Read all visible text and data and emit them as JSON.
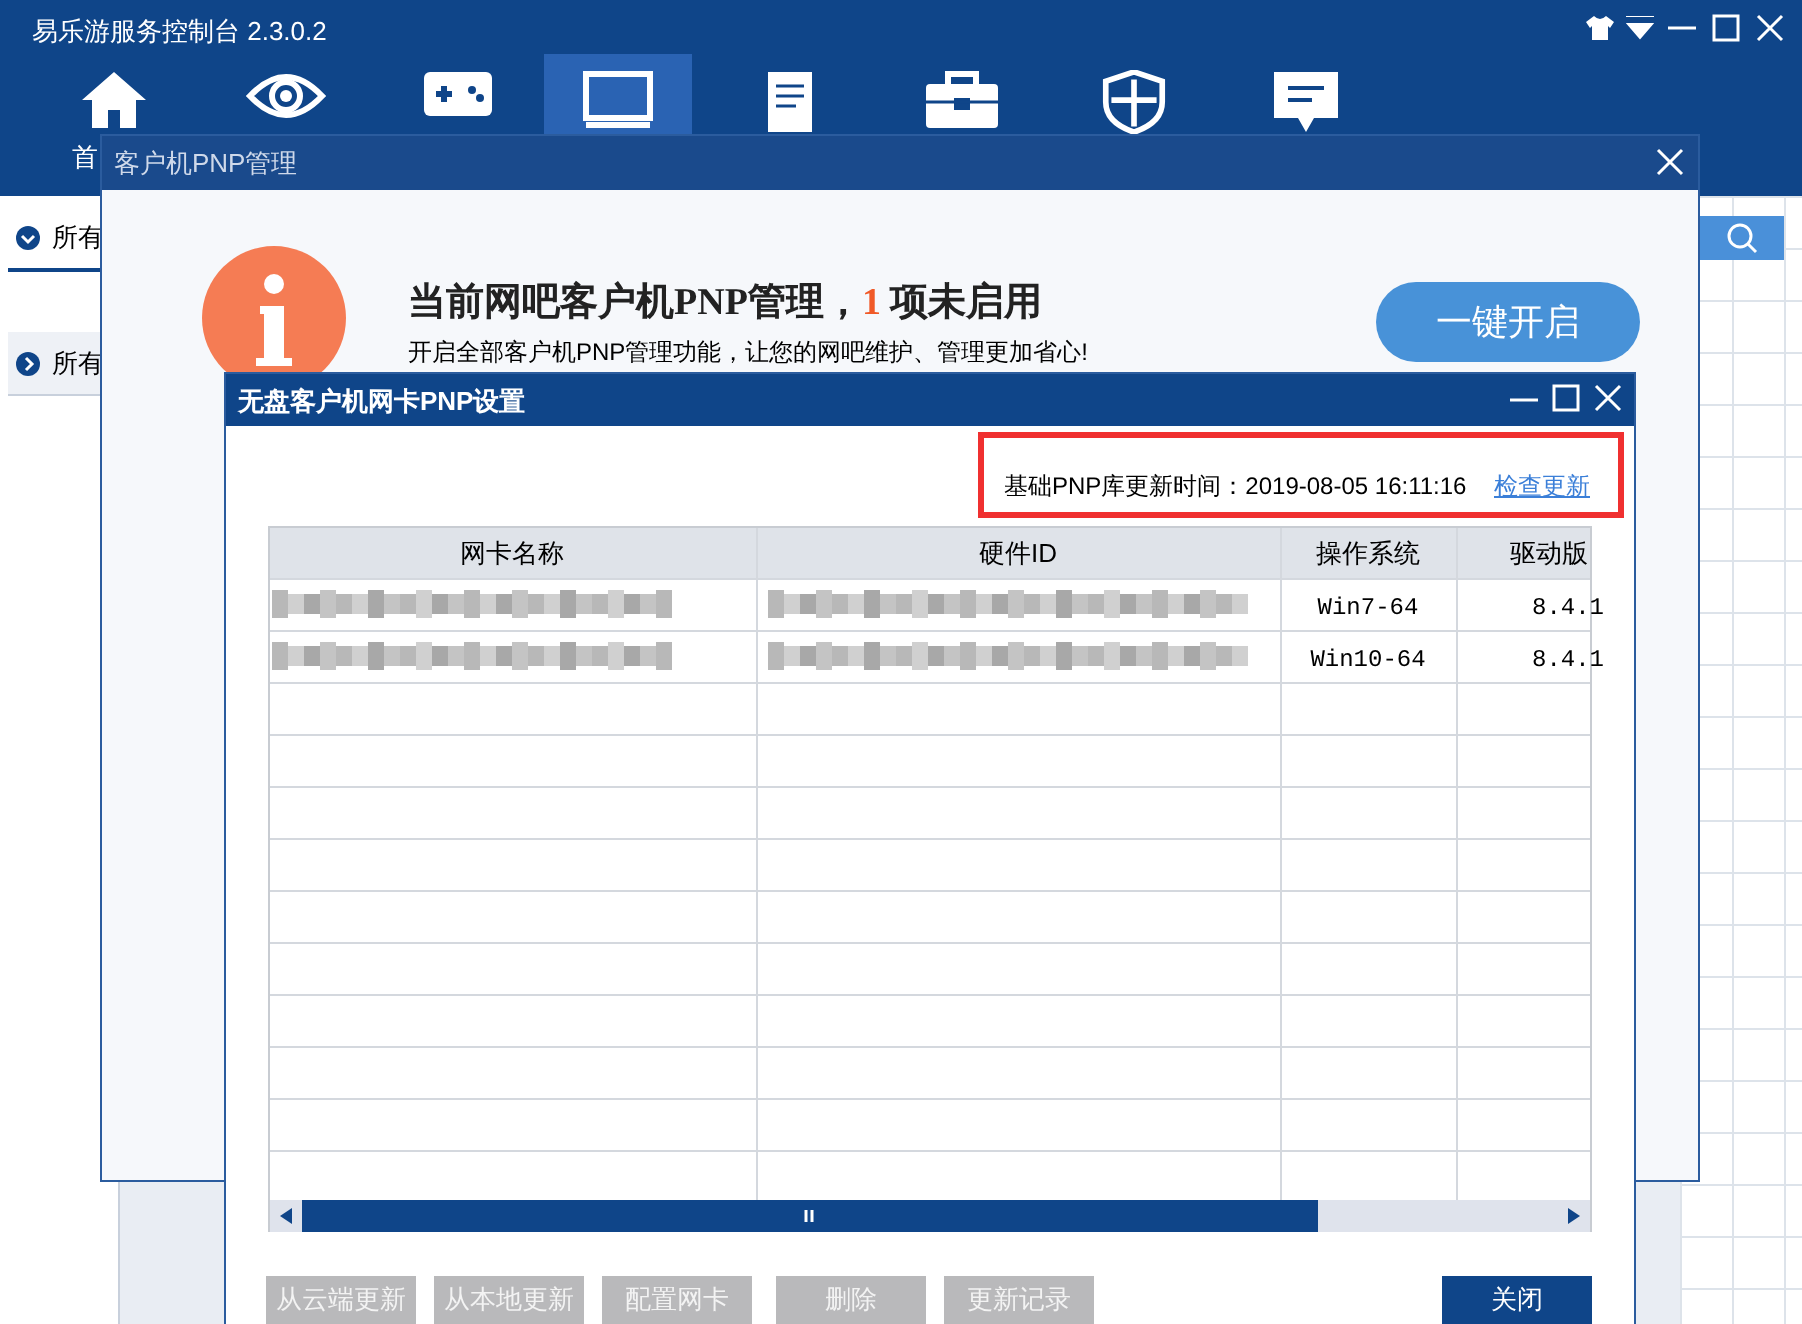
{
  "app": {
    "title": "易乐游服务控制台 2.3.0.2",
    "toolbar": [
      {
        "label": "首",
        "selected": false
      },
      {
        "selected": false
      },
      {
        "selected": false
      },
      {
        "selected": true
      },
      {
        "selected": false
      },
      {
        "selected": false
      },
      {
        "selected": false
      },
      {
        "selected": false
      }
    ],
    "sidebar": [
      {
        "label": "所有",
        "expanded": true
      },
      {
        "label": "所有",
        "expanded": false
      }
    ]
  },
  "pnp_dialog": {
    "title": "客户机PNP管理",
    "headline": "当前网吧客户机PNP管理，",
    "count": "1",
    "headline_tail": "项未启用",
    "subtitle": "开启全部客户机PNP管理功能，让您的网吧维护、管理更加省心!",
    "enable_button": "一键开启"
  },
  "nic_dialog": {
    "title": "无盘客户机网卡PNP设置",
    "update_label": "基础PNP库更新时间：2019-08-05 16:11:16",
    "check_link": "检查更新",
    "columns": [
      "网卡名称",
      "硬件ID",
      "操作系统",
      "驱动版"
    ],
    "rows": [
      {
        "os": "Win7-64",
        "driver": "8.4.1"
      },
      {
        "os": "Win10-64",
        "driver": "8.4.1"
      }
    ],
    "buttons": [
      {
        "label": "从云端更新",
        "disabled": true
      },
      {
        "label": "从本地更新",
        "disabled": true
      },
      {
        "label": "配置网卡",
        "disabled": true
      },
      {
        "label": "删除",
        "disabled": true
      },
      {
        "label": "更新记录",
        "disabled": true
      }
    ],
    "close_button": "关闭"
  }
}
